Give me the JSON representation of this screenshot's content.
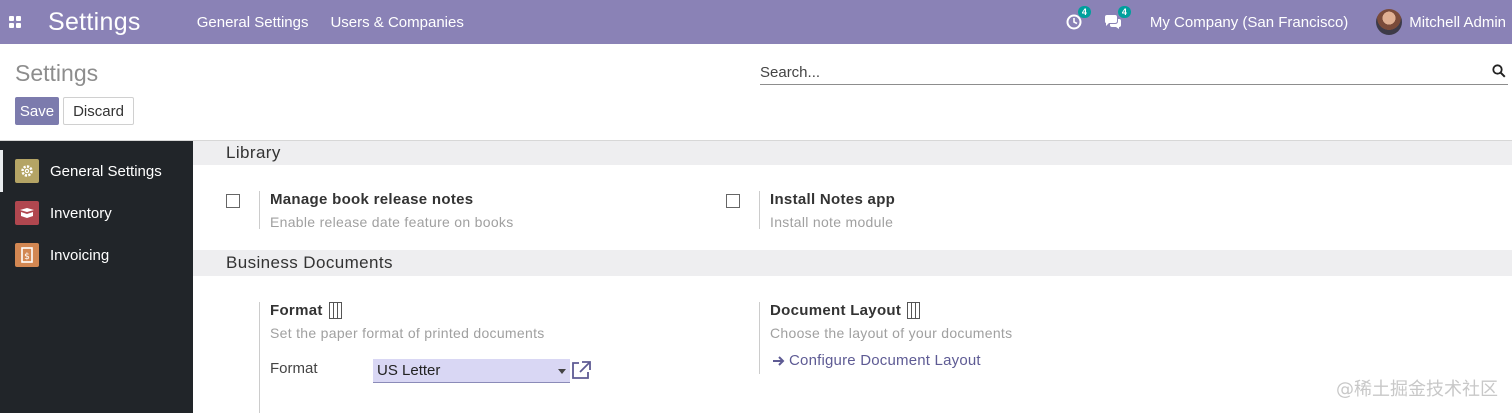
{
  "navbar": {
    "brand": "Settings",
    "menus": [
      "General Settings",
      "Users & Companies"
    ],
    "activity_badge": "4",
    "messages_badge": "4",
    "company": "My Company (San Francisco)",
    "user": "Mitchell Admin"
  },
  "control_panel": {
    "title": "Settings",
    "save_label": "Save",
    "discard_label": "Discard",
    "search_placeholder": "Search..."
  },
  "sidebar": {
    "items": [
      {
        "label": "General Settings",
        "icon": "gear-icon",
        "color": "#b4a465"
      },
      {
        "label": "Inventory",
        "icon": "box-icon",
        "color": "#b0474f"
      },
      {
        "label": "Invoicing",
        "icon": "invoice-icon",
        "color": "#d28752"
      }
    ]
  },
  "library": {
    "title": "Library",
    "release_notes_label": "Manage book release notes",
    "release_notes_desc": "Enable release date feature on books",
    "notes_app_label": "Install Notes app",
    "notes_app_desc": "Install note module"
  },
  "business_documents": {
    "title": "Business Documents",
    "format_label": "Format",
    "format_desc": "Set the paper format of printed documents",
    "format_field_label": "Format",
    "format_value": "US Letter",
    "layout_label": "Document Layout",
    "layout_desc": "Choose the layout of your documents",
    "configure_link": "Configure Document Layout"
  },
  "watermark": "@稀土掘金技术社区",
  "colors": {
    "navbar": "#8a82b6",
    "primary_button": "#7c7bad",
    "sidebar": "#212529",
    "badge": "#00a09d",
    "link": "#5e5b94"
  }
}
